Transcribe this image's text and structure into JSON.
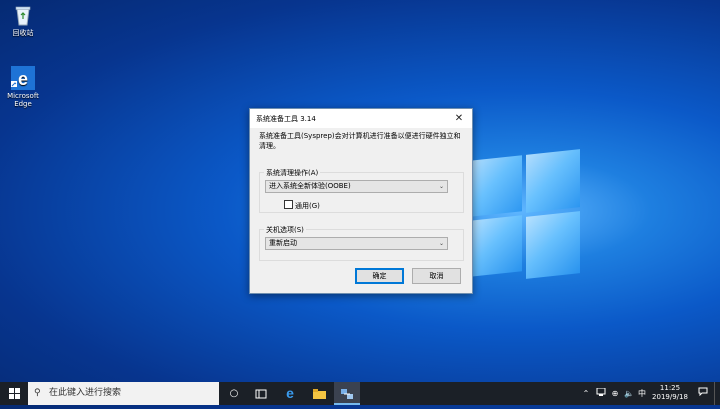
{
  "desktop": {
    "icons": [
      {
        "label": "回收站",
        "icon": "recycle-bin-icon"
      },
      {
        "label": "Microsoft Edge",
        "icon": "edge-icon"
      }
    ]
  },
  "dialog": {
    "title": "系统准备工具 3.14",
    "close_label": "✕",
    "description": "系统准备工具(Sysprep)会对计算机进行准备以便进行硬件独立和清理。",
    "cleanup_group": {
      "label": "系统清理操作(A)",
      "selected": "进入系统全新体验(OOBE)",
      "checkbox_label": "通用(G)",
      "checkbox_checked": false
    },
    "shutdown_group": {
      "label": "关机选项(S)",
      "selected": "重新启动"
    },
    "ok_label": "确定",
    "cancel_label": "取消"
  },
  "taskbar": {
    "search_placeholder": "在此键入进行搜索",
    "tray_input_label": "中",
    "clock_time": "11:25",
    "clock_date": "2019/9/18",
    "accent": "#76b9ed"
  }
}
